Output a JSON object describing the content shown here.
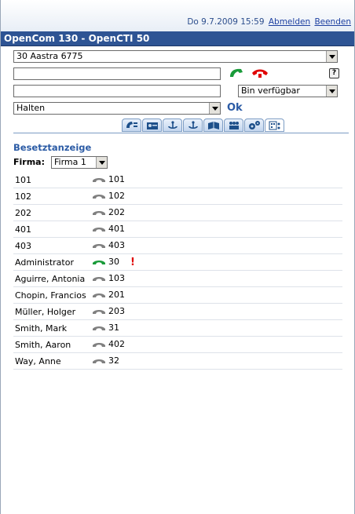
{
  "header": {
    "datetime": "Do 9.7.2009 15:59",
    "logout_label": "Abmelden",
    "quit_label": "Beenden"
  },
  "title": "OpenCom 130 - OpenCTI 50",
  "device_select": {
    "value": "30 Aastra 6775"
  },
  "dial_input": {
    "value": ""
  },
  "status_select": {
    "value": "Bin verfügbar"
  },
  "action_select": {
    "value": "Halten"
  },
  "ok_label": "Ok",
  "tabs": [
    {
      "icon": "phone-list-icon"
    },
    {
      "icon": "card-icon"
    },
    {
      "icon": "anchor-icon"
    },
    {
      "icon": "anchor-icon"
    },
    {
      "icon": "book-icon"
    },
    {
      "icon": "people-icon"
    },
    {
      "icon": "gears-icon"
    },
    {
      "icon": "busy-lamp-icon",
      "active": true
    }
  ],
  "section_title": "Besetztanzeige",
  "firma": {
    "label": "Firma:",
    "value": "Firma 1"
  },
  "colors": {
    "idle": "#808080",
    "active": "#1a9b3a",
    "warn": "#e00000"
  },
  "entries": [
    {
      "name": "101",
      "ext": "101",
      "status": "idle"
    },
    {
      "name": "102",
      "ext": "102",
      "status": "idle"
    },
    {
      "name": "202",
      "ext": "202",
      "status": "idle"
    },
    {
      "name": "401",
      "ext": "401",
      "status": "idle"
    },
    {
      "name": "403",
      "ext": "403",
      "status": "idle"
    },
    {
      "name": "Administrator",
      "ext": "30",
      "status": "active",
      "flag": "!"
    },
    {
      "name": "Aguirre, Antonia",
      "ext": "103",
      "status": "idle"
    },
    {
      "name": "Chopin, Francios",
      "ext": "201",
      "status": "idle"
    },
    {
      "name": "Müller, Holger",
      "ext": "203",
      "status": "idle"
    },
    {
      "name": "Smith, Mark",
      "ext": "31",
      "status": "idle"
    },
    {
      "name": "Smith, Aaron",
      "ext": "402",
      "status": "idle"
    },
    {
      "name": "Way, Anne",
      "ext": "32",
      "status": "idle"
    }
  ]
}
